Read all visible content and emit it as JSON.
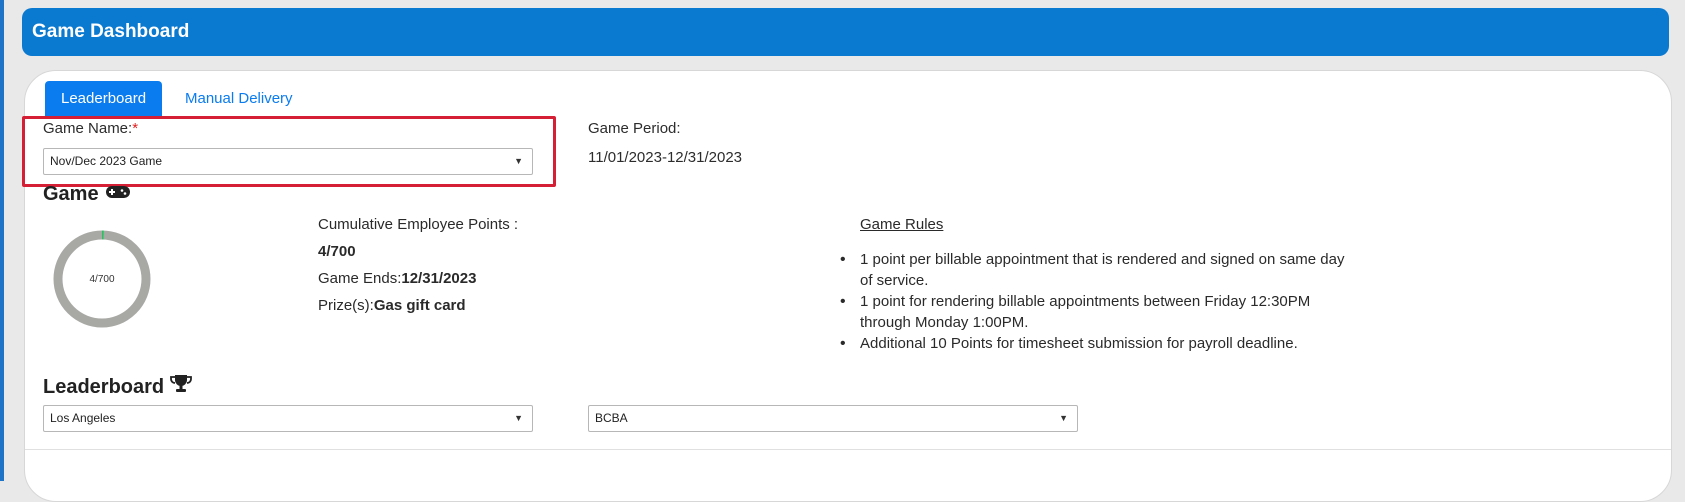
{
  "header": {
    "title": "Game Dashboard"
  },
  "tabs": [
    {
      "label": "Leaderboard",
      "active": true
    },
    {
      "label": "Manual Delivery",
      "active": false
    }
  ],
  "form": {
    "game_name_label": "Game Name:",
    "required_mark": "*",
    "game_name_value": "Nov/Dec 2023 Game",
    "game_period_label": "Game Period:",
    "game_period_value": "11/01/2023-12/31/2023"
  },
  "game_section": {
    "title": "Game",
    "icon": "gamepad-icon",
    "donut_label": "4/700",
    "progress_fraction": 0.0057,
    "cumulative_label": "Cumulative Employee Points :",
    "cumulative_value": "4/700",
    "game_ends_label": "Game Ends:",
    "game_ends_value": "12/31/2023",
    "prize_label": "Prize(s):",
    "prize_value": "Gas gift card"
  },
  "rules": {
    "title": "Game Rules",
    "items": [
      "1 point per billable appointment that is rendered and signed on same day of service.",
      "1 point for rendering billable appointments between Friday 12:30PM through Monday 1:00PM.",
      "Additional 10 Points for timesheet submission for payroll deadline."
    ]
  },
  "leaderboard": {
    "title": "Leaderboard",
    "icon": "trophy-icon",
    "location_value": "Los Angeles",
    "role_value": "BCBA"
  },
  "colors": {
    "header_bg": "#0a79d0",
    "tab_active": "#0a7cf0",
    "highlight": "#d51f34",
    "donut_track": "#a8a8a5",
    "donut_progress": "#22c55e"
  }
}
